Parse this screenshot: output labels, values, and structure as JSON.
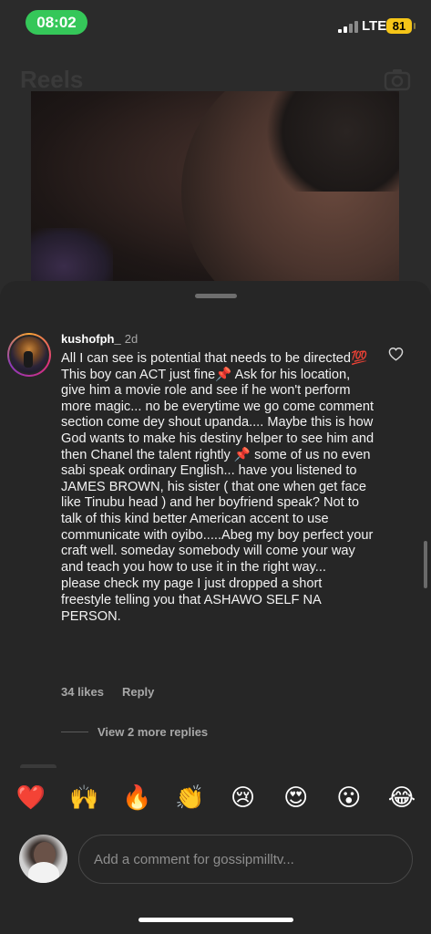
{
  "status_bar": {
    "time": "08:02",
    "network": "LTE",
    "battery": "81",
    "time_pill_color": "#35c759",
    "battery_color": "#f5c518"
  },
  "background": {
    "title": "Reels",
    "camera_icon": "camera-icon"
  },
  "comment": {
    "username": "kushofph_",
    "time": "2d",
    "paragraphs": [
      "All I can see is potential that needs to be directed💯 This boy can ACT just fine📌 Ask for his location, give him a movie role and see if he won't perform more magic... no be everytime we go come comment section come dey shout upanda.... Maybe this is how God wants to make his destiny helper to see him and then Chanel the talent rightly 📌 some of us no even sabi speak ordinary English... have you listened to  JAMES BROWN, his sister ( that one when get face like Tinubu head ) and her boyfriend speak?  Not to talk of this kind better American accent to use communicate with oyibo.....Abeg my boy perfect your craft  well. someday somebody will come your way and teach you how to use it in the right way...",
      "please check my page I just dropped a short freestyle telling you that  ASHAWO SELF NA PERSON."
    ],
    "likes": "34 likes",
    "reply_label": "Reply",
    "view_replies": "View 2 more replies",
    "like_icon": "heart-icon"
  },
  "reactions": [
    "❤️",
    "🙌",
    "🔥",
    "👏",
    "😢",
    "😍",
    "😮",
    "😂"
  ],
  "input": {
    "placeholder": "Add a comment for gossipmilltv..."
  }
}
